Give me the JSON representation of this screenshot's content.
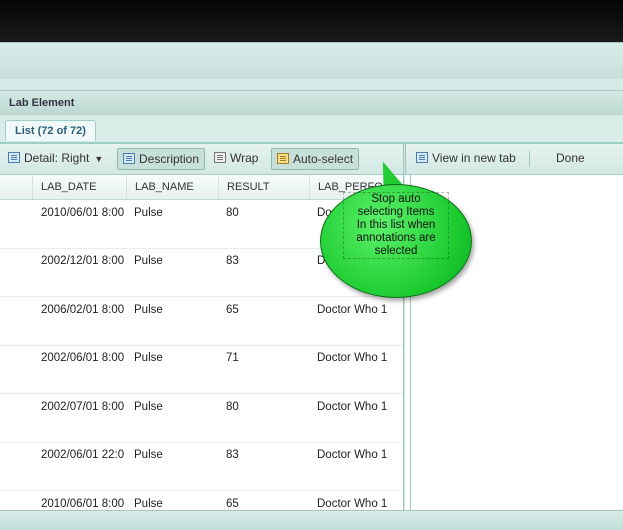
{
  "panel": {
    "title": "Lab Element"
  },
  "tab": {
    "label": "List (72 of 72)"
  },
  "toolbar": {
    "detail_label": "Detail: Right",
    "description_label": "Description",
    "wrap_label": "Wrap",
    "autoselect_label": "Auto-select"
  },
  "columns": [
    "LAB_DATE",
    "LAB_NAME",
    "RESULT",
    "LAB_PERFO"
  ],
  "rows": [
    [
      "2010/06/01 8:00",
      "Pulse",
      "80",
      "Doc"
    ],
    [
      "2002/12/01 8:00",
      "Pulse",
      "83",
      "D"
    ],
    [
      "2006/02/01 8:00",
      "Pulse",
      "65",
      "Doctor Who 1"
    ],
    [
      "2002/06/01 8:00",
      "Pulse",
      "71",
      "Doctor Who 1"
    ],
    [
      "2002/07/01 8:00",
      "Pulse",
      "80",
      "Doctor Who 1"
    ],
    [
      "2002/06/01 22:0",
      "Pulse",
      "83",
      "Doctor Who 1"
    ],
    [
      "2010/06/01 8:00",
      "Pulse",
      "65",
      "Doctor Who 1"
    ]
  ],
  "right_toolbar": {
    "view_new_tab_label": "View in new tab",
    "done_label": "Done"
  },
  "callout": {
    "lines": [
      "Stop auto",
      "selecting Items",
      "In this list when",
      "annotations are",
      "selected"
    ],
    "color": "#22cc35"
  }
}
